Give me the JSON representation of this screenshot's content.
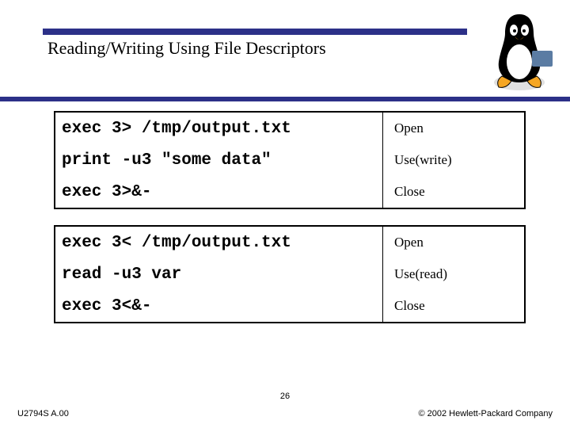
{
  "title": "Reading/Writing Using File Descriptors",
  "table1": {
    "rows": [
      {
        "cmd": "exec 3> /tmp/output.txt",
        "desc": "Open"
      },
      {
        "cmd": "print -u3 \"some data\"",
        "desc": "Use(write)"
      },
      {
        "cmd": "exec 3>&-",
        "desc": "Close"
      }
    ]
  },
  "table2": {
    "rows": [
      {
        "cmd": "exec 3< /tmp/output.txt",
        "desc": "Open"
      },
      {
        "cmd": "read -u3 var",
        "desc": "Use(read)"
      },
      {
        "cmd": "exec 3<&-",
        "desc": "Close"
      }
    ]
  },
  "footer": {
    "left": "U2794S A.00",
    "right": "© 2002 Hewlett-Packard Company",
    "page": "26"
  }
}
